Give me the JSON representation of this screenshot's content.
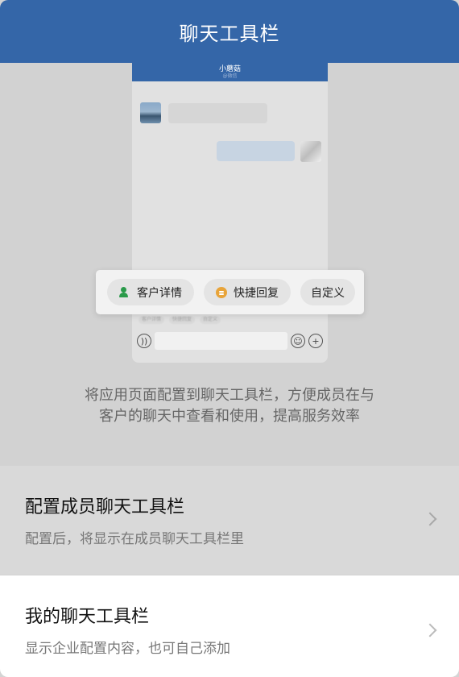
{
  "navbar": {
    "title": "聊天工具栏"
  },
  "preview": {
    "chat_name": "小蘑菇",
    "chat_sub": "@微信",
    "popup": {
      "items": [
        {
          "label": "客户详情",
          "icon": "customer-person-icon"
        },
        {
          "label": "快捷回复",
          "icon": "quick-reply-icon"
        },
        {
          "label": "自定义"
        }
      ]
    },
    "faint_toolbar": [
      "客户详情",
      "快捷回复",
      "自定义"
    ]
  },
  "description": {
    "line1": "将应用页面配置到聊天工具栏，方便成员在与",
    "line2": "客户的聊天中查看和使用，提高服务效率"
  },
  "list": {
    "config": {
      "title": "配置成员聊天工具栏",
      "desc": "配置后，将显示在成员聊天工具栏里"
    },
    "mine": {
      "title": "我的聊天工具栏",
      "desc": "显示企业配置内容，也可自己添加"
    }
  },
  "colors": {
    "brand": "#3466a8",
    "customer_icon": "#2a9a4a",
    "reply_icon": "#e8a43a"
  }
}
